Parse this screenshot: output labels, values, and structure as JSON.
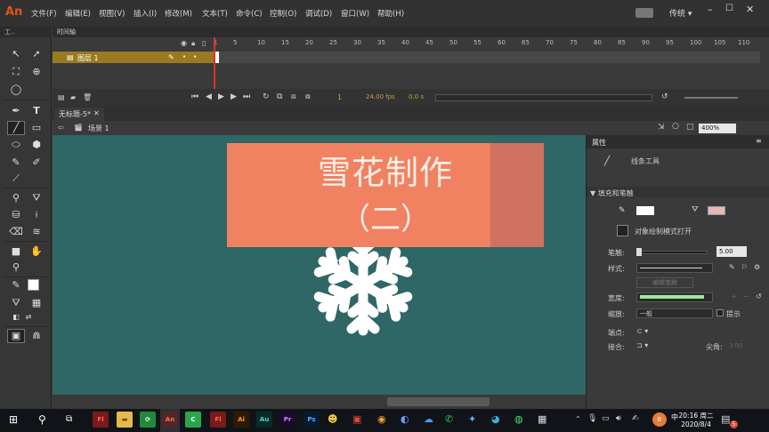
{
  "menubar": {
    "logo": "An",
    "items": [
      "文件(F)",
      "编辑(E)",
      "视图(V)",
      "插入(I)",
      "修改(M)",
      "文本(T)",
      "命令(C)",
      "控制(O)",
      "调试(D)",
      "窗口(W)",
      "帮助(H)"
    ],
    "layout_mode": "传统 ▾"
  },
  "toolbox": {
    "title": "工.."
  },
  "timeline": {
    "panel_title": "时间轴",
    "layer_name": "图层 1",
    "frame_numbers": [
      "1",
      "5",
      "10",
      "15",
      "20",
      "25",
      "30",
      "35",
      "40",
      "45",
      "50",
      "55",
      "60",
      "65",
      "70",
      "75",
      "80",
      "85",
      "90",
      "95",
      "100",
      "105",
      "110"
    ],
    "current_frame": "1",
    "fps": "24.00 fps",
    "time": "0.0 s"
  },
  "document": {
    "tab_label": "无标题-5*",
    "scene_label": "场景 1",
    "zoom": "400%"
  },
  "slide": {
    "title_line1": "雪花制作",
    "title_line2": "（二）"
  },
  "properties": {
    "panel_title": "属性",
    "tool_name": "线条工具",
    "section_fill_stroke": "▼ 填充和笔触",
    "object_drawing_label": "对象绘制模式打开",
    "stroke_label": "笔触:",
    "stroke_value": "5.00",
    "style_label": "样式:",
    "edit_style_button": "编辑笔触",
    "width_label": "宽度:",
    "scale_label": "缩放:",
    "scale_value": "一般",
    "hint_label": "提示",
    "cap_label": "端点:",
    "join_label": "接合:",
    "miter_label": "尖角:",
    "miter_value": "3.00"
  },
  "taskbar": {
    "time": "20:16 周二",
    "date": "2020/8/4",
    "notification_count": "5",
    "apps": [
      {
        "label": "Fl",
        "color": "#7a1a1a",
        "fg": "#ff6a5a"
      },
      {
        "label": "▬",
        "color": "#e8b84a",
        "fg": "#6a4a10"
      },
      {
        "label": "⟳",
        "color": "#1f8a3e",
        "fg": "#ffffff"
      },
      {
        "label": "An",
        "color": "#3a0b0b",
        "fg": "#ff5a3a"
      },
      {
        "label": "C",
        "color": "#2aa64a",
        "fg": "#ffffff"
      },
      {
        "label": "Fl",
        "color": "#7a1a1a",
        "fg": "#ff6a5a"
      },
      {
        "label": "Ai",
        "color": "#2c1a05",
        "fg": "#ff9a1a"
      },
      {
        "label": "Au",
        "color": "#062a2a",
        "fg": "#4ad8c8"
      },
      {
        "label": "Pr",
        "color": "#1a0a2a",
        "fg": "#c88aff"
      },
      {
        "label": "Ps",
        "color": "#081a2e",
        "fg": "#4ab0ff"
      }
    ],
    "colors": {
      "accent": "#e87a3a"
    }
  },
  "colors": {
    "stage": "#2e6765",
    "slide_banner": "#f08262",
    "slide_banner_dark": "#cf7260",
    "stroke_color": "#ffffff",
    "playhead": "#e03030",
    "layer_highlight": "#9a7a20",
    "brand": "#e0541b"
  }
}
